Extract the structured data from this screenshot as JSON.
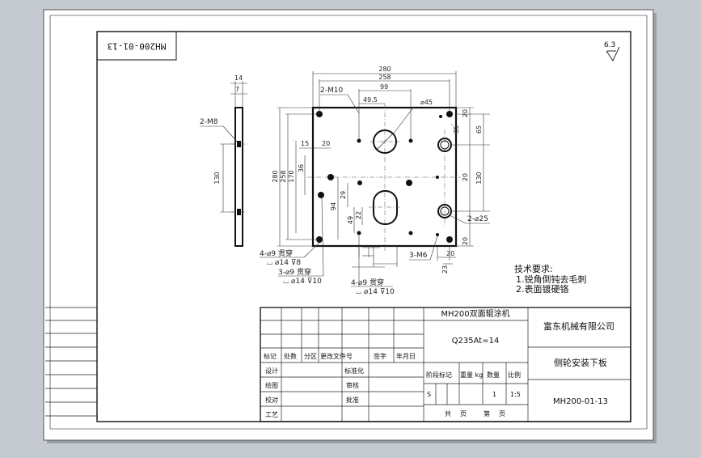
{
  "drawing": {
    "stamp_code": "MH200-01-13",
    "roughness": "6.3",
    "side_view": {
      "thickness": "14",
      "edge": "7",
      "hole_label": "2-M8",
      "spacing": "130"
    },
    "front_view": {
      "width_total": "280",
      "width_inner": "258",
      "hole_m10": "2-M10",
      "dist_99": "99",
      "dist_49_5": "49.5",
      "dia_45": "⌀45",
      "height_total": "280",
      "height_inner": "258",
      "dim_170": "170",
      "dim_15": "15",
      "dim_20_left": "20",
      "dim_36": "36",
      "dim_94": "94",
      "dim_29": "29",
      "dim_49": "49",
      "dim_22": "22",
      "dim_65": "65",
      "dim_130_right": "130",
      "dim_35": "35",
      "dia_25": "2-⌀25",
      "dim_23": "23",
      "dim_20_bottom": "20",
      "thread_m6": "3-M6",
      "note_a_line1": "4-⌀9 贯穿",
      "note_a_line2": "⌴ ⌀14 ⊽8",
      "note_b_line1": "3-⌀9 贯穿",
      "note_b_line2": "⌴ ⌀14 ⊽10",
      "note_c_line1": "4-⌀9 贯穿",
      "note_c_line2": "⌴ ⌀14 ⊽10"
    },
    "tech_requirements": {
      "heading": "技术要求:",
      "items": [
        "1.锐角倒钝去毛刺",
        "2.表面镀硬铬"
      ]
    },
    "title_block": {
      "product_name": "MH200双面辊涂机",
      "material": "Q235At=14",
      "company": "富东机械有限公司",
      "part_name": "侧轮安装下板",
      "drawing_no": "MH200-01-13",
      "hdr_mark": "标记",
      "hdr_count": "处数",
      "hdr_zone": "分区",
      "hdr_doc": "更改文件号",
      "hdr_sign": "签字",
      "hdr_date": "年月日",
      "lbl_design": "设计",
      "lbl_standard": "标准化",
      "lbl_drawn": "绘图",
      "lbl_review": "审核",
      "lbl_check": "校对",
      "lbl_approve": "批准",
      "lbl_process": "工艺",
      "lbl_stage": "阶段标记",
      "lbl_weight": "重量 kg",
      "lbl_qty": "数量",
      "lbl_scale": "比例",
      "val_stage": "S",
      "val_qty": "1",
      "val_scale": "1:5",
      "lbl_total": "共",
      "lbl_sheets": "页",
      "lbl_sheet_no": "第",
      "lbl_page": "页"
    }
  }
}
